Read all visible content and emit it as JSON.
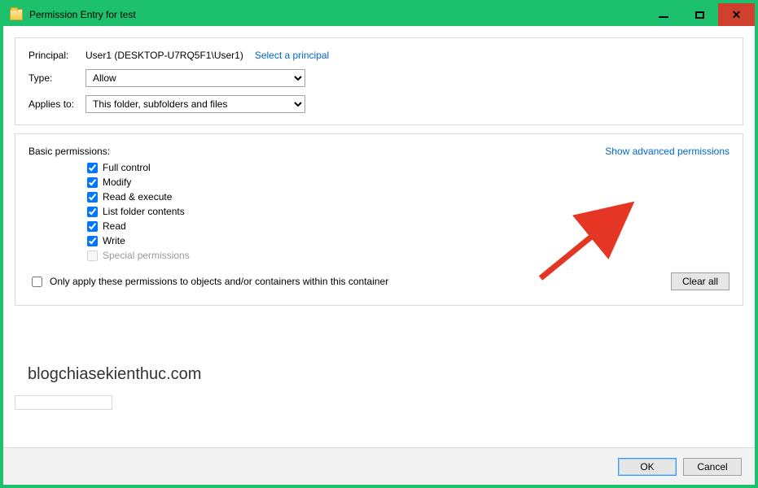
{
  "window": {
    "title": "Permission Entry for test"
  },
  "principal": {
    "label": "Principal:",
    "value": "User1 (DESKTOP-U7RQ5F1\\User1)",
    "select_link": "Select a principal"
  },
  "type": {
    "label": "Type:",
    "value": "Allow"
  },
  "applies": {
    "label": "Applies to:",
    "value": "This folder, subfolders and files"
  },
  "basic_permissions": {
    "header": "Basic permissions:",
    "advanced_link": "Show advanced permissions",
    "items": [
      {
        "label": "Full control",
        "checked": true,
        "enabled": true
      },
      {
        "label": "Modify",
        "checked": true,
        "enabled": true
      },
      {
        "label": "Read & execute",
        "checked": true,
        "enabled": true
      },
      {
        "label": "List folder contents",
        "checked": true,
        "enabled": true
      },
      {
        "label": "Read",
        "checked": true,
        "enabled": true
      },
      {
        "label": "Write",
        "checked": true,
        "enabled": true
      },
      {
        "label": "Special permissions",
        "checked": false,
        "enabled": false
      }
    ]
  },
  "only_apply": {
    "label": "Only apply these permissions to objects and/or containers within this container",
    "checked": false
  },
  "clear_all": "Clear all",
  "footer": {
    "ok": "OK",
    "cancel": "Cancel"
  },
  "watermark": "blogchiasekienthuc.com"
}
